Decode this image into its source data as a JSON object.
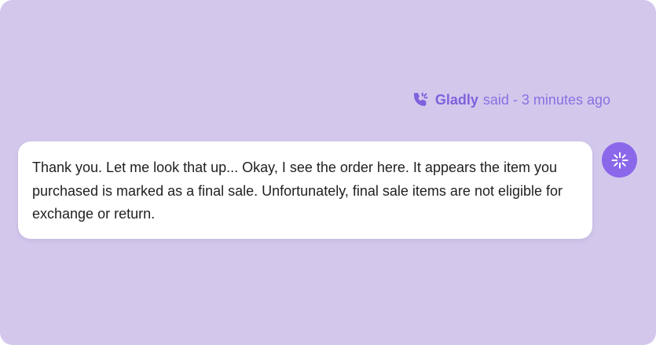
{
  "message": {
    "sender": "Gladly",
    "meta_suffix": "said - 3 minutes ago",
    "channel_icon": "phone-call-icon",
    "text": "Thank you. Let me look that up... Okay, I see the order here. It appears the item you purchased is marked as a final sale. Unfortunately, final sale items are not eligible for exchange or return.",
    "avatar_icon": "sparkle-burst-icon"
  },
  "colors": {
    "background": "#d3c8ec",
    "accent": "#8b68ea",
    "bubble": "#ffffff",
    "text": "#1f1f1f"
  }
}
